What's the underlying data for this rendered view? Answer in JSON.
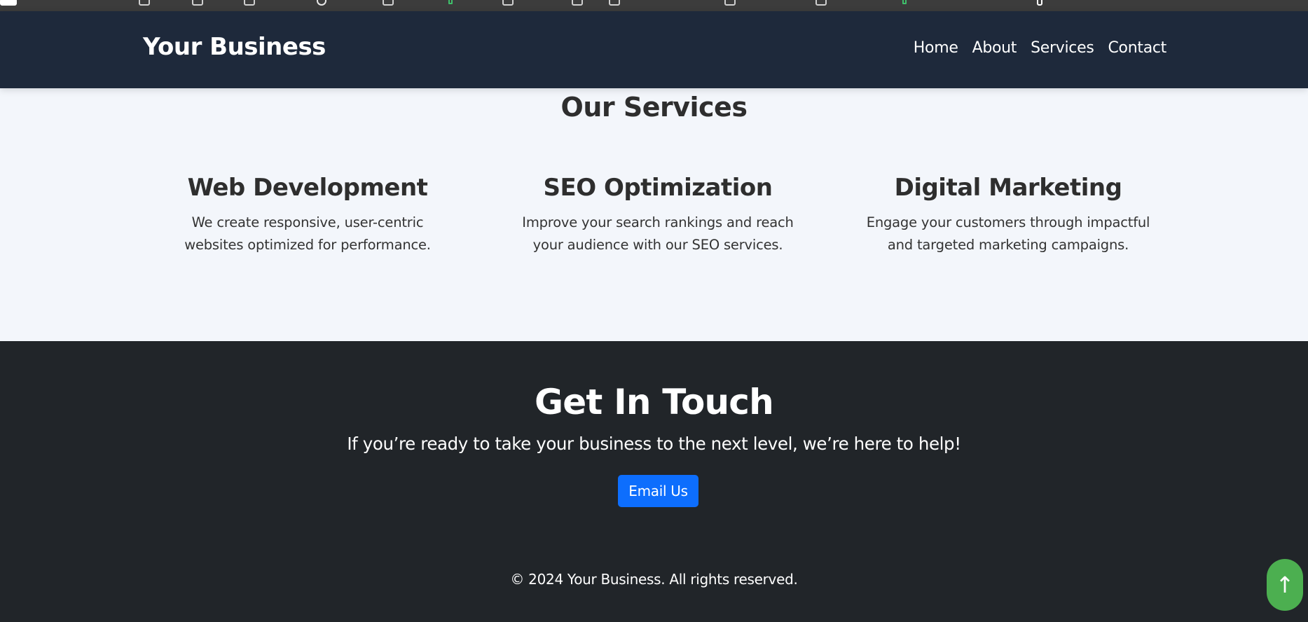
{
  "header": {
    "brand": "Your Business",
    "nav": [
      "Home",
      "About",
      "Services",
      "Contact"
    ],
    "background": "#1e293b"
  },
  "services": {
    "title": "Our Services",
    "items": [
      {
        "title": "Web Development",
        "description": "We create responsive, user-centric websites optimized for performance."
      },
      {
        "title": "SEO Optimization",
        "description": "Improve your search rankings and reach your audience with our SEO services."
      },
      {
        "title": "Digital Marketing",
        "description": "Engage your customers through impactful and targeted marketing campaigns."
      }
    ]
  },
  "contact": {
    "title": "Get In Touch",
    "text": "If you’re ready to take your business to the next level, we’re here to help!",
    "button_label": "Email Us",
    "button_color": "#0d6efd",
    "background": "#212529"
  },
  "footer": {
    "copyright": "© 2024 Your Business. All rights reserved."
  },
  "scroll_top": {
    "icon": "arrow-up-icon",
    "glyph": "↑",
    "color": "#4caf50"
  }
}
